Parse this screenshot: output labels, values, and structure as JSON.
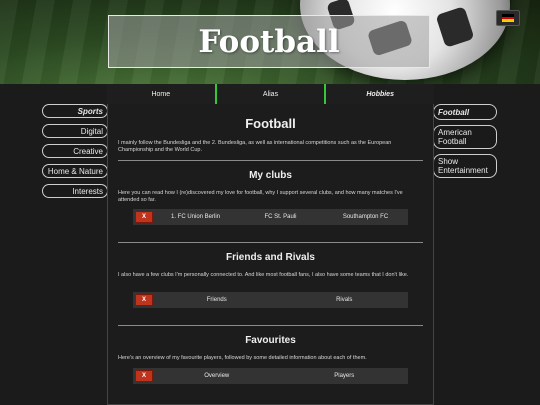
{
  "header": {
    "title": "Football",
    "language_flag": {
      "icon": "german-flag-icon",
      "colors": [
        "#000000",
        "#dd0000",
        "#ffce00"
      ]
    }
  },
  "top_nav": {
    "tabs": [
      {
        "label": "Home"
      },
      {
        "label": "Alias"
      },
      {
        "label": "Hobbies"
      }
    ],
    "accent_color": "#37c837"
  },
  "left_nav": {
    "items": [
      {
        "label": "Sports"
      },
      {
        "label": "Digital"
      },
      {
        "label": "Creative"
      },
      {
        "label": "Home & Nature"
      },
      {
        "label": "Interests"
      }
    ]
  },
  "right_nav": {
    "items": [
      {
        "label": "Football"
      },
      {
        "label": "American Football"
      },
      {
        "label": "Show Entertainment"
      }
    ]
  },
  "main": {
    "title": "Football",
    "intro": "I mainly follow the Bundesliga and the 2. Bundesliga, as well as international competitions such as the European Championship and the World Cup.",
    "sections": [
      {
        "heading": "My clubs",
        "text": "Here you can read how I (re)discovered my love for football, why I support several clubs, and how many matches I've attended so far.",
        "close_label": "X",
        "tabs": [
          "1. FC Union Berlin",
          "FC St. Pauli",
          "Southampton FC"
        ]
      },
      {
        "heading": "Friends and Rivals",
        "text": "I also have a few clubs I'm personally connected to. And like most football fans, I also have some teams that I don't like.",
        "close_label": "X",
        "tabs": [
          "Friends",
          "Rivals"
        ]
      },
      {
        "heading": "Favourites",
        "text": "Here's an overview of my favourite players, followed by some detailed information about each of them.",
        "close_label": "X",
        "tabs": [
          "Overview",
          "Players"
        ]
      }
    ]
  }
}
